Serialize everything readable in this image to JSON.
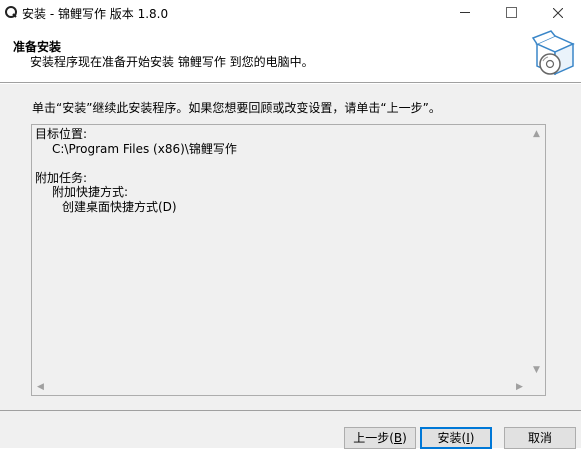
{
  "window": {
    "title": "安装 - 锦鲤写作 版本 1.8.0"
  },
  "header": {
    "title": "准备安装",
    "subtitle": "安装程序现在准备开始安装 锦鲤写作 到您的电脑中。"
  },
  "main": {
    "instruction": "单击“安装”继续此安装程序。如果您想要回顾或改变设置，请单击“上一步”。",
    "memo_lines": {
      "l0": "目标位置:",
      "l1": "C:\\Program Files (x86)\\锦鲤写作",
      "l2": "",
      "l3": "附加任务:",
      "l4": "附加快捷方式:",
      "l5": "创建桌面快捷方式(D)"
    }
  },
  "buttons": {
    "back_text": "上一步(",
    "back_key": "B",
    "back_close": ")",
    "install_text": "安装(",
    "install_key": "I",
    "install_close": ")",
    "cancel": "取消"
  },
  "icons": {
    "app": "app-icon",
    "header": "software-box-disc-icon"
  }
}
